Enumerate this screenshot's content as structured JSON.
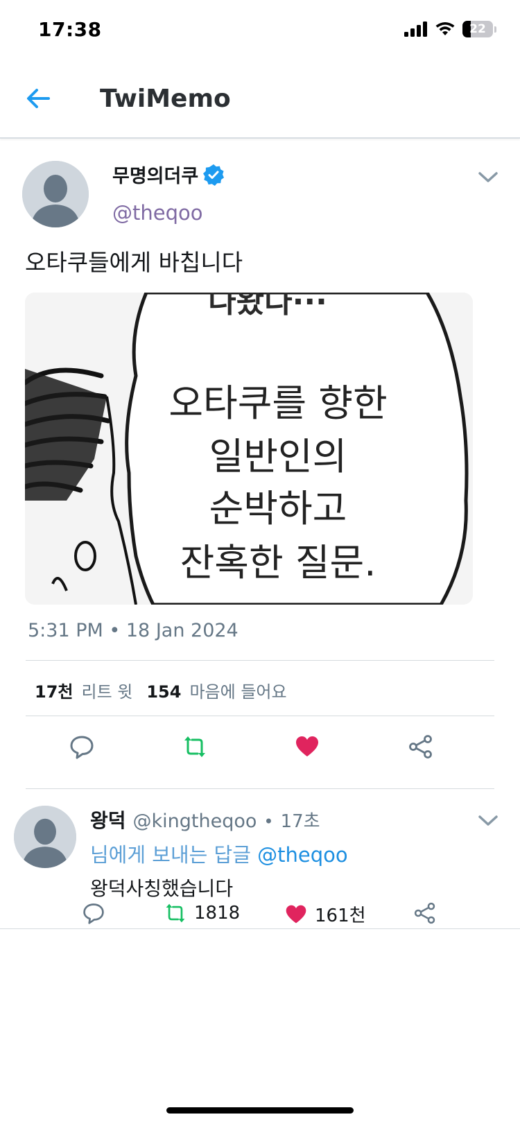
{
  "status_bar": {
    "time": "17:38",
    "battery": "22",
    "icons": [
      "signal-icon",
      "wifi-icon",
      "battery-icon"
    ]
  },
  "nav": {
    "back_icon": "arrow-left-icon",
    "title": "TwiMemo",
    "accent_color": "#1d9bf0"
  },
  "tweet": {
    "author": {
      "display_name": "무명의더쿠",
      "handle": "@theqoo",
      "verified": true
    },
    "text": "오타쿠들에게 바칩니다",
    "media": {
      "lines": [
        "오타쿠를 향한",
        "일반인의",
        "순박하고",
        "잔혹한 질문."
      ],
      "top_partial": "나왔다···"
    },
    "timestamp": "5:31 PM • 18 Jan 2024",
    "stats": {
      "retweets_count": "17천",
      "retweets_label": "리트 윗",
      "likes_count": "154",
      "likes_label": "마음에 들어요"
    },
    "actions": [
      "reply-icon",
      "retweet-icon",
      "like-icon",
      "share-icon"
    ],
    "colors": {
      "retweet": "#17bf63",
      "like": "#e0245e",
      "verified": "#1d9bf0"
    }
  },
  "reply": {
    "name": "왕덕",
    "handle": "@kingtheqoo",
    "dot": "•",
    "time": "17초",
    "reply_to_prefix": "님에게 보내는 답글",
    "reply_to_mention": "@theqoo",
    "text": "왕덕사칭했습니다",
    "retweet_count": "1818",
    "like_count": "161천"
  }
}
